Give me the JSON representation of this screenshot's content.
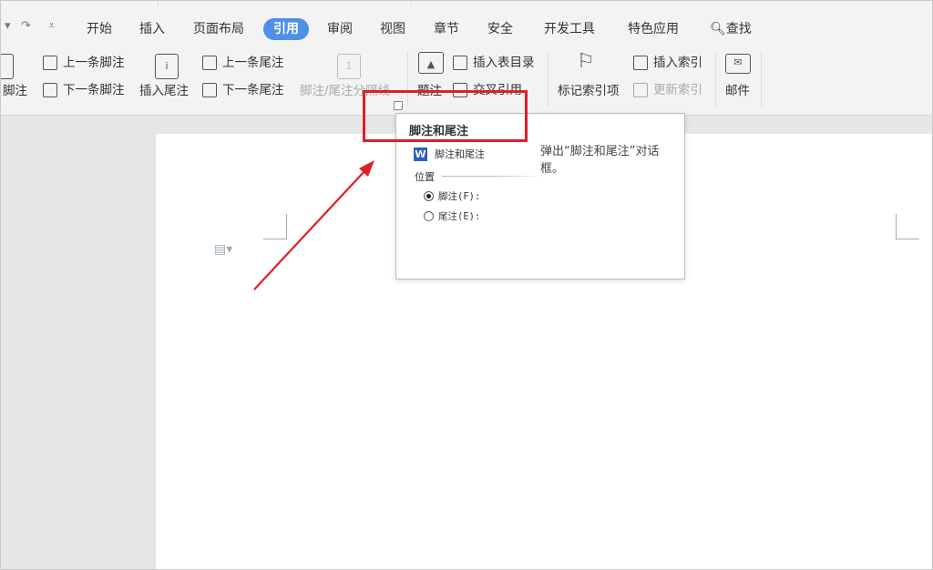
{
  "menu": {
    "tabs": [
      "开始",
      "插入",
      "页面布局",
      "引用",
      "审阅",
      "视图",
      "章节",
      "安全",
      "开发工具",
      "特色应用"
    ],
    "active_tab": "引用",
    "search_label": "查找"
  },
  "ribbon": {
    "insert_footnote": "脚注",
    "prev_footnote": "上一条脚注",
    "next_footnote": "下一条脚注",
    "insert_endnote": "插入尾注",
    "prev_endnote": "上一条尾注",
    "next_endnote": "下一条尾注",
    "separator": "脚注/尾注分隔线",
    "caption": "题注",
    "insert_toc": "插入表目录",
    "cross_ref": "交叉引用",
    "mark_index": "标记索引项",
    "insert_index": "插入索引",
    "update_index": "更新索引",
    "mail": "邮件"
  },
  "tooltip": {
    "title": "脚注和尾注",
    "preview": {
      "dialog_title": "脚注和尾注",
      "section_label": "位置",
      "options": [
        "脚注(F):",
        "尾注(E):"
      ],
      "selected": 0
    },
    "description": "弹出“脚注和尾注”对话框。"
  },
  "colors": {
    "active_tab": "#4f8fe6",
    "annotation": "#e01e24",
    "word_icon": "#2b5fbf"
  }
}
